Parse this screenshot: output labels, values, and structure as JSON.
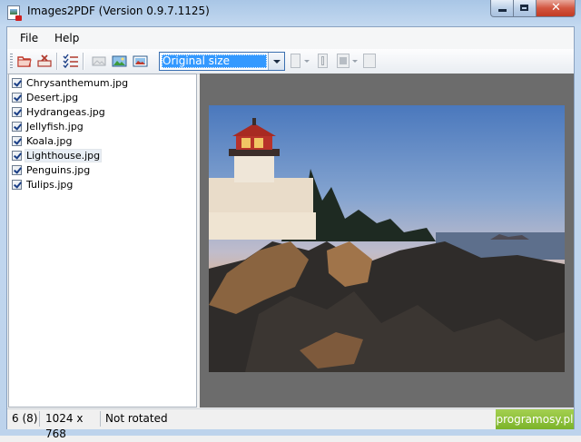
{
  "window": {
    "title": "Images2PDF (Version 0.9.7.1125)"
  },
  "menu": {
    "items": [
      "File",
      "Help"
    ]
  },
  "toolbar": {
    "zoom_select": {
      "value": "Original size"
    }
  },
  "files": [
    {
      "name": "Chrysanthemum.jpg",
      "checked": true
    },
    {
      "name": "Desert.jpg",
      "checked": true
    },
    {
      "name": "Hydrangeas.jpg",
      "checked": true
    },
    {
      "name": "Jellyfish.jpg",
      "checked": true
    },
    {
      "name": "Koala.jpg",
      "checked": true
    },
    {
      "name": "Lighthouse.jpg",
      "checked": true,
      "selected": true
    },
    {
      "name": "Penguins.jpg",
      "checked": true
    },
    {
      "name": "Tulips.jpg",
      "checked": true
    }
  ],
  "status": {
    "count": "6 (8)",
    "dimensions": "1024 x 768",
    "rotation": "Not rotated"
  },
  "badge": "programosy.pl",
  "colors": {
    "selection": "#3399ff",
    "badge": "#8cc13a",
    "preview_bg": "#6c6c6c"
  }
}
